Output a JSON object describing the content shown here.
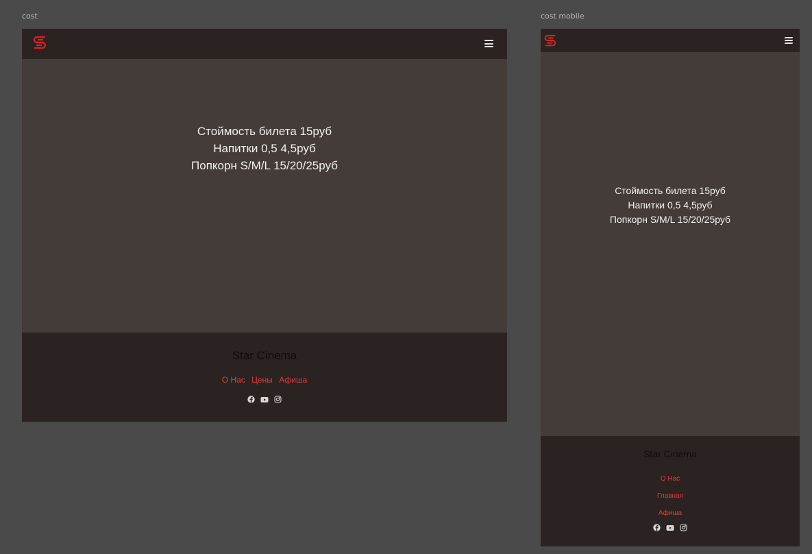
{
  "colors": {
    "canvas": "#4a4a4a",
    "frame_bg": "#433c39",
    "nav_bg": "#2b2322",
    "accent": "#e23a38",
    "text": "#f0f0f0"
  },
  "desktop": {
    "frame_label": "cost",
    "logo_icon": "star-cinema-logo-icon",
    "menu_icon": "hamburger-menu-icon",
    "prices": [
      "Стоймость билета 15руб",
      "Напитки 0,5 4,5руб",
      "Попкорн S/M/L 15/20/25руб"
    ],
    "footer": {
      "brand": "Star Cinema",
      "links": [
        "О Нас",
        "Цены",
        "Афиша"
      ],
      "socials": [
        "facebook-icon",
        "youtube-icon",
        "instagram-icon"
      ]
    }
  },
  "mobile": {
    "frame_label": "cost mobile",
    "logo_icon": "star-cinema-logo-icon",
    "menu_icon": "hamburger-menu-icon",
    "prices": [
      "Стоймость билета 15руб",
      "Напитки 0,5 4,5руб",
      "Попкорн S/M/L 15/20/25руб"
    ],
    "footer": {
      "brand": "Star Cinema",
      "links": [
        "О Нас",
        "Главная",
        "Афиша"
      ],
      "socials": [
        "facebook-icon",
        "youtube-icon",
        "instagram-icon"
      ]
    }
  }
}
